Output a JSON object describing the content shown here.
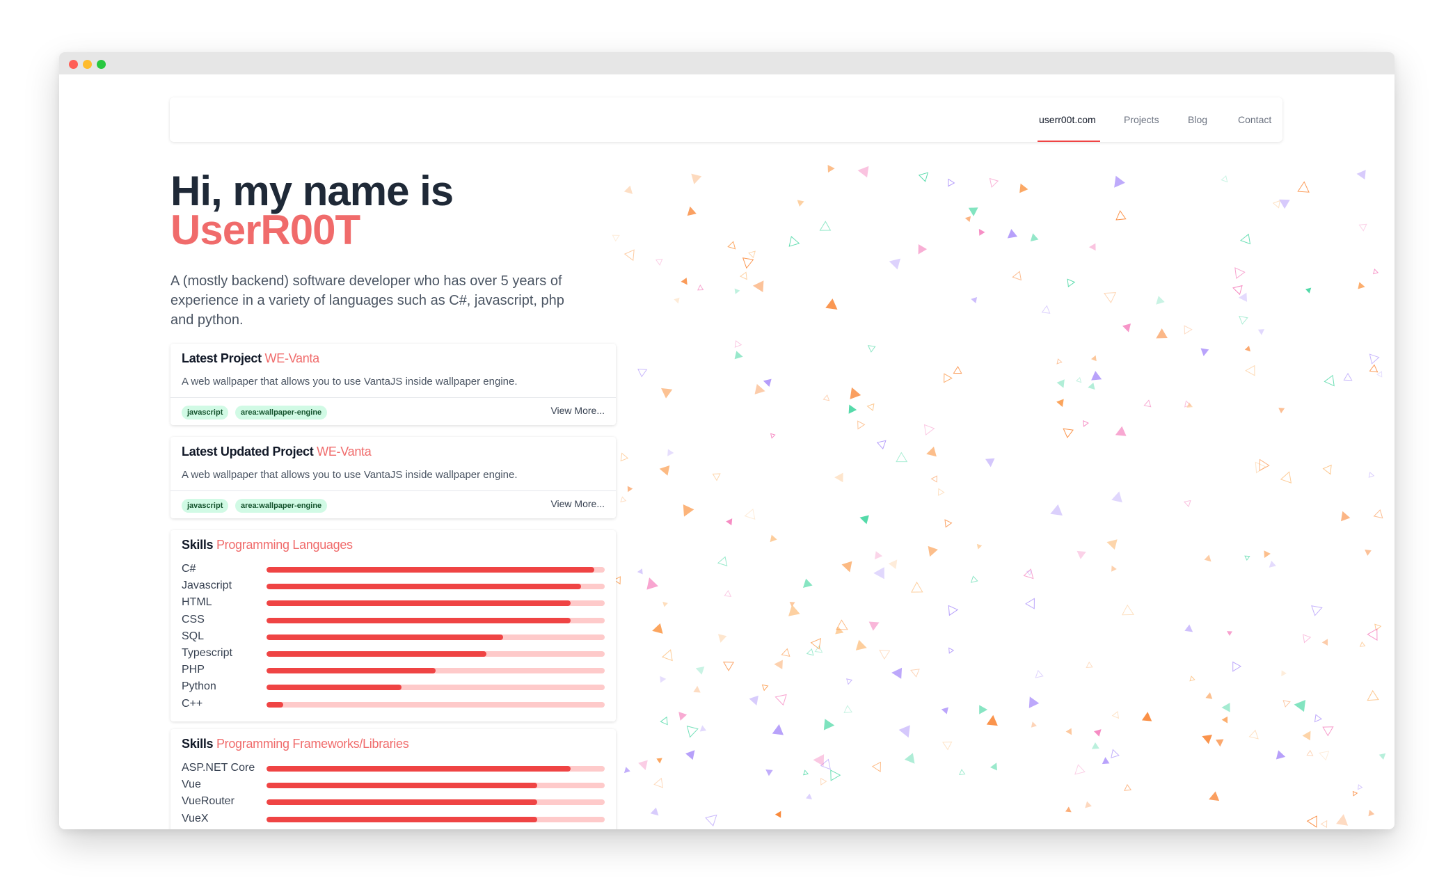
{
  "nav": {
    "items": [
      {
        "label": "userr00t.com",
        "active": true
      },
      {
        "label": "Projects",
        "active": false
      },
      {
        "label": "Blog",
        "active": false
      },
      {
        "label": "Contact",
        "active": false
      }
    ]
  },
  "hero": {
    "greeting": "Hi, my name is",
    "name": "UserR00T",
    "description": "A (mostly backend) software developer who has over 5 years of experience in a variety of languages such as C#, javascript, php and python."
  },
  "latest_project": {
    "label": "Latest Project",
    "name": "WE-Vanta",
    "description": "A web wallpaper that allows you to use VantaJS inside wallpaper engine.",
    "tags": [
      "javascript",
      "area:wallpaper-engine"
    ],
    "view_more": "View More..."
  },
  "latest_updated_project": {
    "label": "Latest Updated Project",
    "name": "WE-Vanta",
    "description": "A web wallpaper that allows you to use VantaJS inside wallpaper engine.",
    "tags": [
      "javascript",
      "area:wallpaper-engine"
    ],
    "view_more": "View More..."
  },
  "skills_languages": {
    "label": "Skills",
    "category": "Programming Languages",
    "items": [
      {
        "name": "C#",
        "level": 0.97
      },
      {
        "name": "Javascript",
        "level": 0.93
      },
      {
        "name": "HTML",
        "level": 0.9
      },
      {
        "name": "CSS",
        "level": 0.9
      },
      {
        "name": "SQL",
        "level": 0.7
      },
      {
        "name": "Typescript",
        "level": 0.65
      },
      {
        "name": "PHP",
        "level": 0.5
      },
      {
        "name": "Python",
        "level": 0.4
      },
      {
        "name": "C++",
        "level": 0.05
      }
    ]
  },
  "skills_frameworks": {
    "label": "Skills",
    "category": "Programming Frameworks/Libraries",
    "items": [
      {
        "name": "ASP.NET Core",
        "level": 0.9
      },
      {
        "name": "Vue",
        "level": 0.8
      },
      {
        "name": "VueRouter",
        "level": 0.8
      },
      {
        "name": "VueX",
        "level": 0.8
      }
    ]
  },
  "colors": {
    "accent": "#f06b6b",
    "bar_fill": "#ef4444",
    "bar_track": "#fecaca",
    "tag_bg": "#d1fae5",
    "particle_colors": [
      "#f97316",
      "#fb923c",
      "#a78bfa",
      "#34d399",
      "#f472b6",
      "#fdba74"
    ]
  }
}
